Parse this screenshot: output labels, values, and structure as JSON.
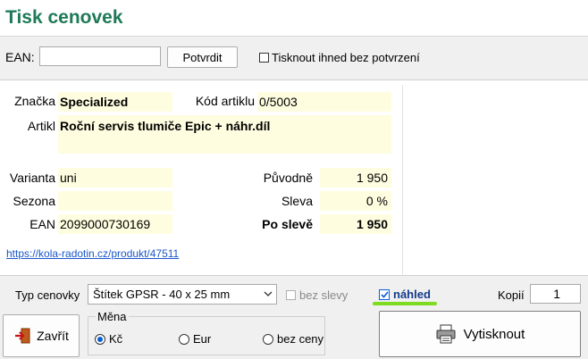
{
  "title": "Tisk cenovek",
  "ean_bar": {
    "label": "EAN:",
    "value": "",
    "confirm_button": "Potvrdit",
    "print_without_confirm": "Tisknout ihned bez potvrzení"
  },
  "product": {
    "brand_label": "Značka",
    "brand": "Specialized",
    "code_label": "Kód artiklu",
    "code": "0/5003",
    "article_label": "Artikl",
    "article": "Roční servis tlumiče Epic + náhr.díl",
    "variant_label": "Varianta",
    "variant": "uni",
    "season_label": "Sezona",
    "season": "",
    "ean_label": "EAN",
    "ean": "2099000730169",
    "original_label": "Původně",
    "original": "1 950",
    "discount_label": "Sleva",
    "discount": "0 %",
    "after_discount_label": "Po slevě",
    "after_discount": "1 950",
    "link": "https://kola-radotin.cz/produkt/47511"
  },
  "bottom": {
    "label_type_label": "Typ cenovky",
    "label_type_value": "Štítek GPSR - 40 x 25 mm",
    "no_discount": "bez slevy",
    "preview": "náhled",
    "copies_label": "Kopií",
    "copies": "1",
    "close_button": "Zavřít",
    "currency_group": "Měna",
    "currency_options": [
      "Kč",
      "Eur",
      "bez ceny"
    ],
    "print_button": "Vytisknout"
  },
  "colors": {
    "title": "#1e7a58",
    "field_bg": "#fffde0",
    "accent_check": "#0a5fd8",
    "highlight": "#7ddc1f"
  },
  "icons": [
    "close-door-icon",
    "printer-icon",
    "dropdown-chevron-icon"
  ]
}
